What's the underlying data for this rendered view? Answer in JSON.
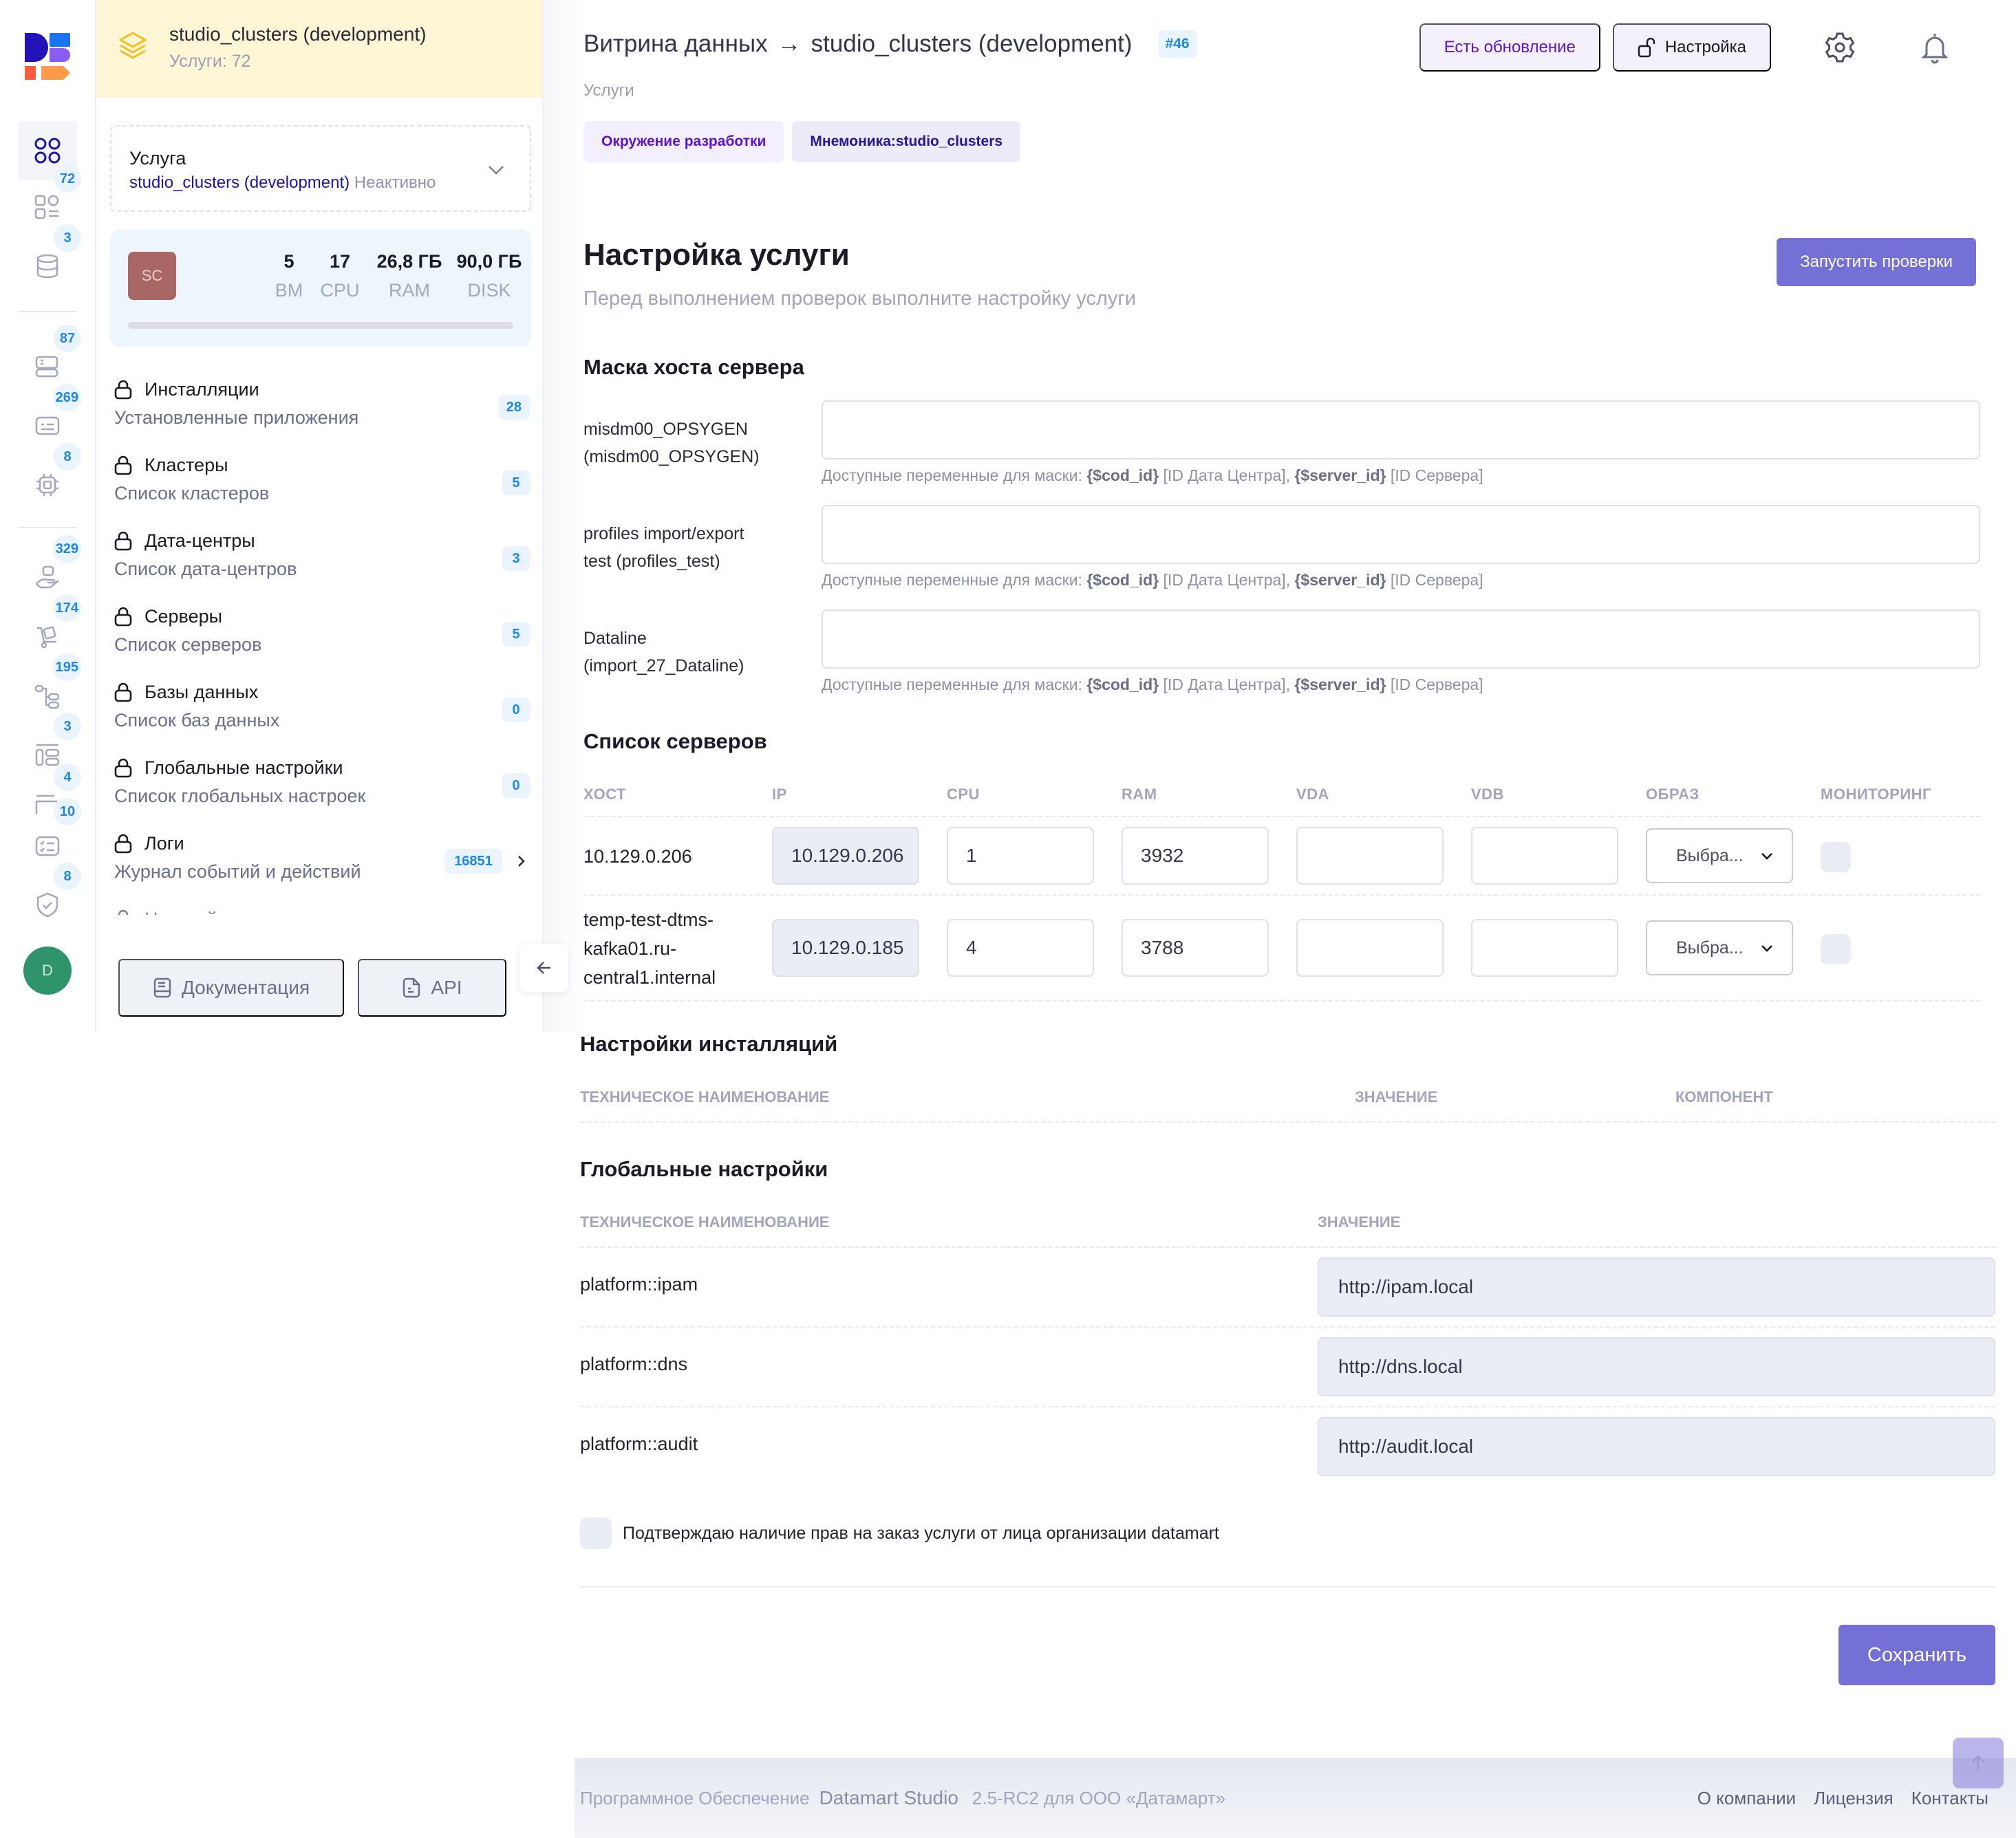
{
  "rail": {
    "items": [
      {
        "icon": "grid-icon",
        "badge": null,
        "active": true
      },
      {
        "icon": "services-list-icon",
        "badge": "72"
      },
      {
        "icon": "database-icon",
        "badge": "3"
      },
      {
        "icon": "server-icon",
        "badge": "87"
      },
      {
        "icon": "terminal-icon",
        "badge": "269"
      },
      {
        "icon": "chip-icon",
        "badge": "8"
      },
      {
        "icon": "hand-box-icon",
        "badge": "329"
      },
      {
        "icon": "cart-icon",
        "badge": "174"
      },
      {
        "icon": "tree-icon",
        "badge": "195"
      },
      {
        "icon": "layout-icon",
        "badge": "3"
      },
      {
        "icon": "stack-icon",
        "badge": "4"
      },
      {
        "icon": "checklist-icon",
        "badge": "10"
      },
      {
        "icon": "shield-check-icon",
        "badge": "8"
      }
    ],
    "avatar": "D"
  },
  "sidebar": {
    "header": {
      "title": "studio_clusters (development)",
      "subtitle": "Услуги: 72"
    },
    "service_select": {
      "label": "Услуга",
      "value": "studio_clusters (development)",
      "state": "Неактивно"
    },
    "resources": {
      "avatar": "SC",
      "stats": [
        {
          "value": "5",
          "label": "ВМ"
        },
        {
          "value": "17",
          "label": "CPU"
        },
        {
          "value": "26,8 ГБ",
          "label": "RAM"
        },
        {
          "value": "90,0 ГБ",
          "label": "DISK"
        }
      ],
      "usage_fraction": 0
    },
    "nav": [
      {
        "title": "Инсталляции",
        "subtitle": "Установленные приложения",
        "count": "28"
      },
      {
        "title": "Кластеры",
        "subtitle": "Список кластеров",
        "count": "5"
      },
      {
        "title": "Дата-центры",
        "subtitle": "Список дата-центров",
        "count": "3"
      },
      {
        "title": "Серверы",
        "subtitle": "Список серверов",
        "count": "5"
      },
      {
        "title": "Базы данных",
        "subtitle": "Список баз данных",
        "count": "0"
      },
      {
        "title": "Глобальные настройки",
        "subtitle": "Список глобальных настроек",
        "count": "0"
      },
      {
        "title": "Логи",
        "subtitle": "Журнал событий и действий",
        "count": "16851"
      },
      {
        "title": "Настройки",
        "subtitle": "",
        "count": ""
      }
    ],
    "buttons": {
      "docs": "Документация",
      "api": "API"
    }
  },
  "header": {
    "breadcrumb_root": "Витрина данных",
    "breadcrumb_arrow": "→",
    "breadcrumb_current": "studio_clusters (development)",
    "id_badge": "#46",
    "subtitle": "Услуги",
    "tags": [
      "Окружение разработки",
      "Мнемоника:studio_clusters"
    ],
    "update_button": "Есть обновление",
    "settings_button": "Настройка"
  },
  "content": {
    "title": "Настройка услуги",
    "description": "Перед выполнением проверок выполните настройку услуги",
    "run_checks": "Запустить проверки",
    "mask_section": "Маска хоста сервера",
    "masks": [
      {
        "label_line1": "misdm00_OPSYGEN",
        "label_line2": "(misdm00_OPSYGEN)",
        "value": ""
      },
      {
        "label_line1": "profiles import/export",
        "label_line2": "test (profiles_test)",
        "value": ""
      },
      {
        "label_line1": "Dataline",
        "label_line2": "(import_27_Dataline)",
        "value": ""
      }
    ],
    "mask_hint": {
      "prefix": "Доступные переменные для маски: ",
      "var1": "{$cod_id}",
      "desc1": " [ID Дата Центра], ",
      "var2": "{$server_id}",
      "desc2": " [ID Сервера]"
    },
    "servers_section": "Список серверов",
    "server_columns": [
      "ХОСТ",
      "IP",
      "CPU",
      "RAM",
      "VDA",
      "VDB",
      "ОБРАЗ",
      "МОНИТОРИНГ"
    ],
    "servers": [
      {
        "host_lines": [
          "10.129.0.206"
        ],
        "ip": "10.129.0.206",
        "cpu": "1",
        "ram": "3932",
        "vda": "",
        "vdb": "",
        "image": "Выбра...",
        "monitoring": false
      },
      {
        "host_lines": [
          "temp-test-dtms-",
          "kafka01.ru-",
          "central1.internal"
        ],
        "ip": "10.129.0.185",
        "cpu": "4",
        "ram": "3788",
        "vda": "",
        "vdb": "",
        "image": "Выбра...",
        "monitoring": false
      }
    ],
    "install_section": "Настройки инсталляций",
    "install_columns": [
      "ТЕХНИЧЕСКОЕ НАИМЕНОВАНИЕ",
      "ЗНАЧЕНИЕ",
      "КОМПОНЕНТ"
    ],
    "global_section": "Глобальные настройки",
    "global_columns": [
      "ТЕХНИЧЕСКОЕ НАИМЕНОВАНИЕ",
      "ЗНАЧЕНИЕ"
    ],
    "global_settings": [
      {
        "name": "platform::ipam",
        "value": "http://ipam.local"
      },
      {
        "name": "platform::dns",
        "value": "http://dns.local"
      },
      {
        "name": "platform::audit",
        "value": "http://audit.local"
      }
    ],
    "confirm_label": "Подтверждаю наличие прав на заказ услуги от лица организации datamart",
    "save": "Сохранить"
  },
  "footer": {
    "prefix": "Программное Обеспечение",
    "brand": "Datamart Studio",
    "version": "2.5-RC2 для ООО «Датамарт»",
    "links": [
      "О компании",
      "Лицензия",
      "Контакты"
    ]
  },
  "colors": {
    "accent": "#7470d6",
    "badge_text": "#1e88e5",
    "header_card": "#fff6d6",
    "env_tag_text": "#5d12d2",
    "avatar_green": "#2f9469",
    "avatar_sc": "#a86664"
  }
}
